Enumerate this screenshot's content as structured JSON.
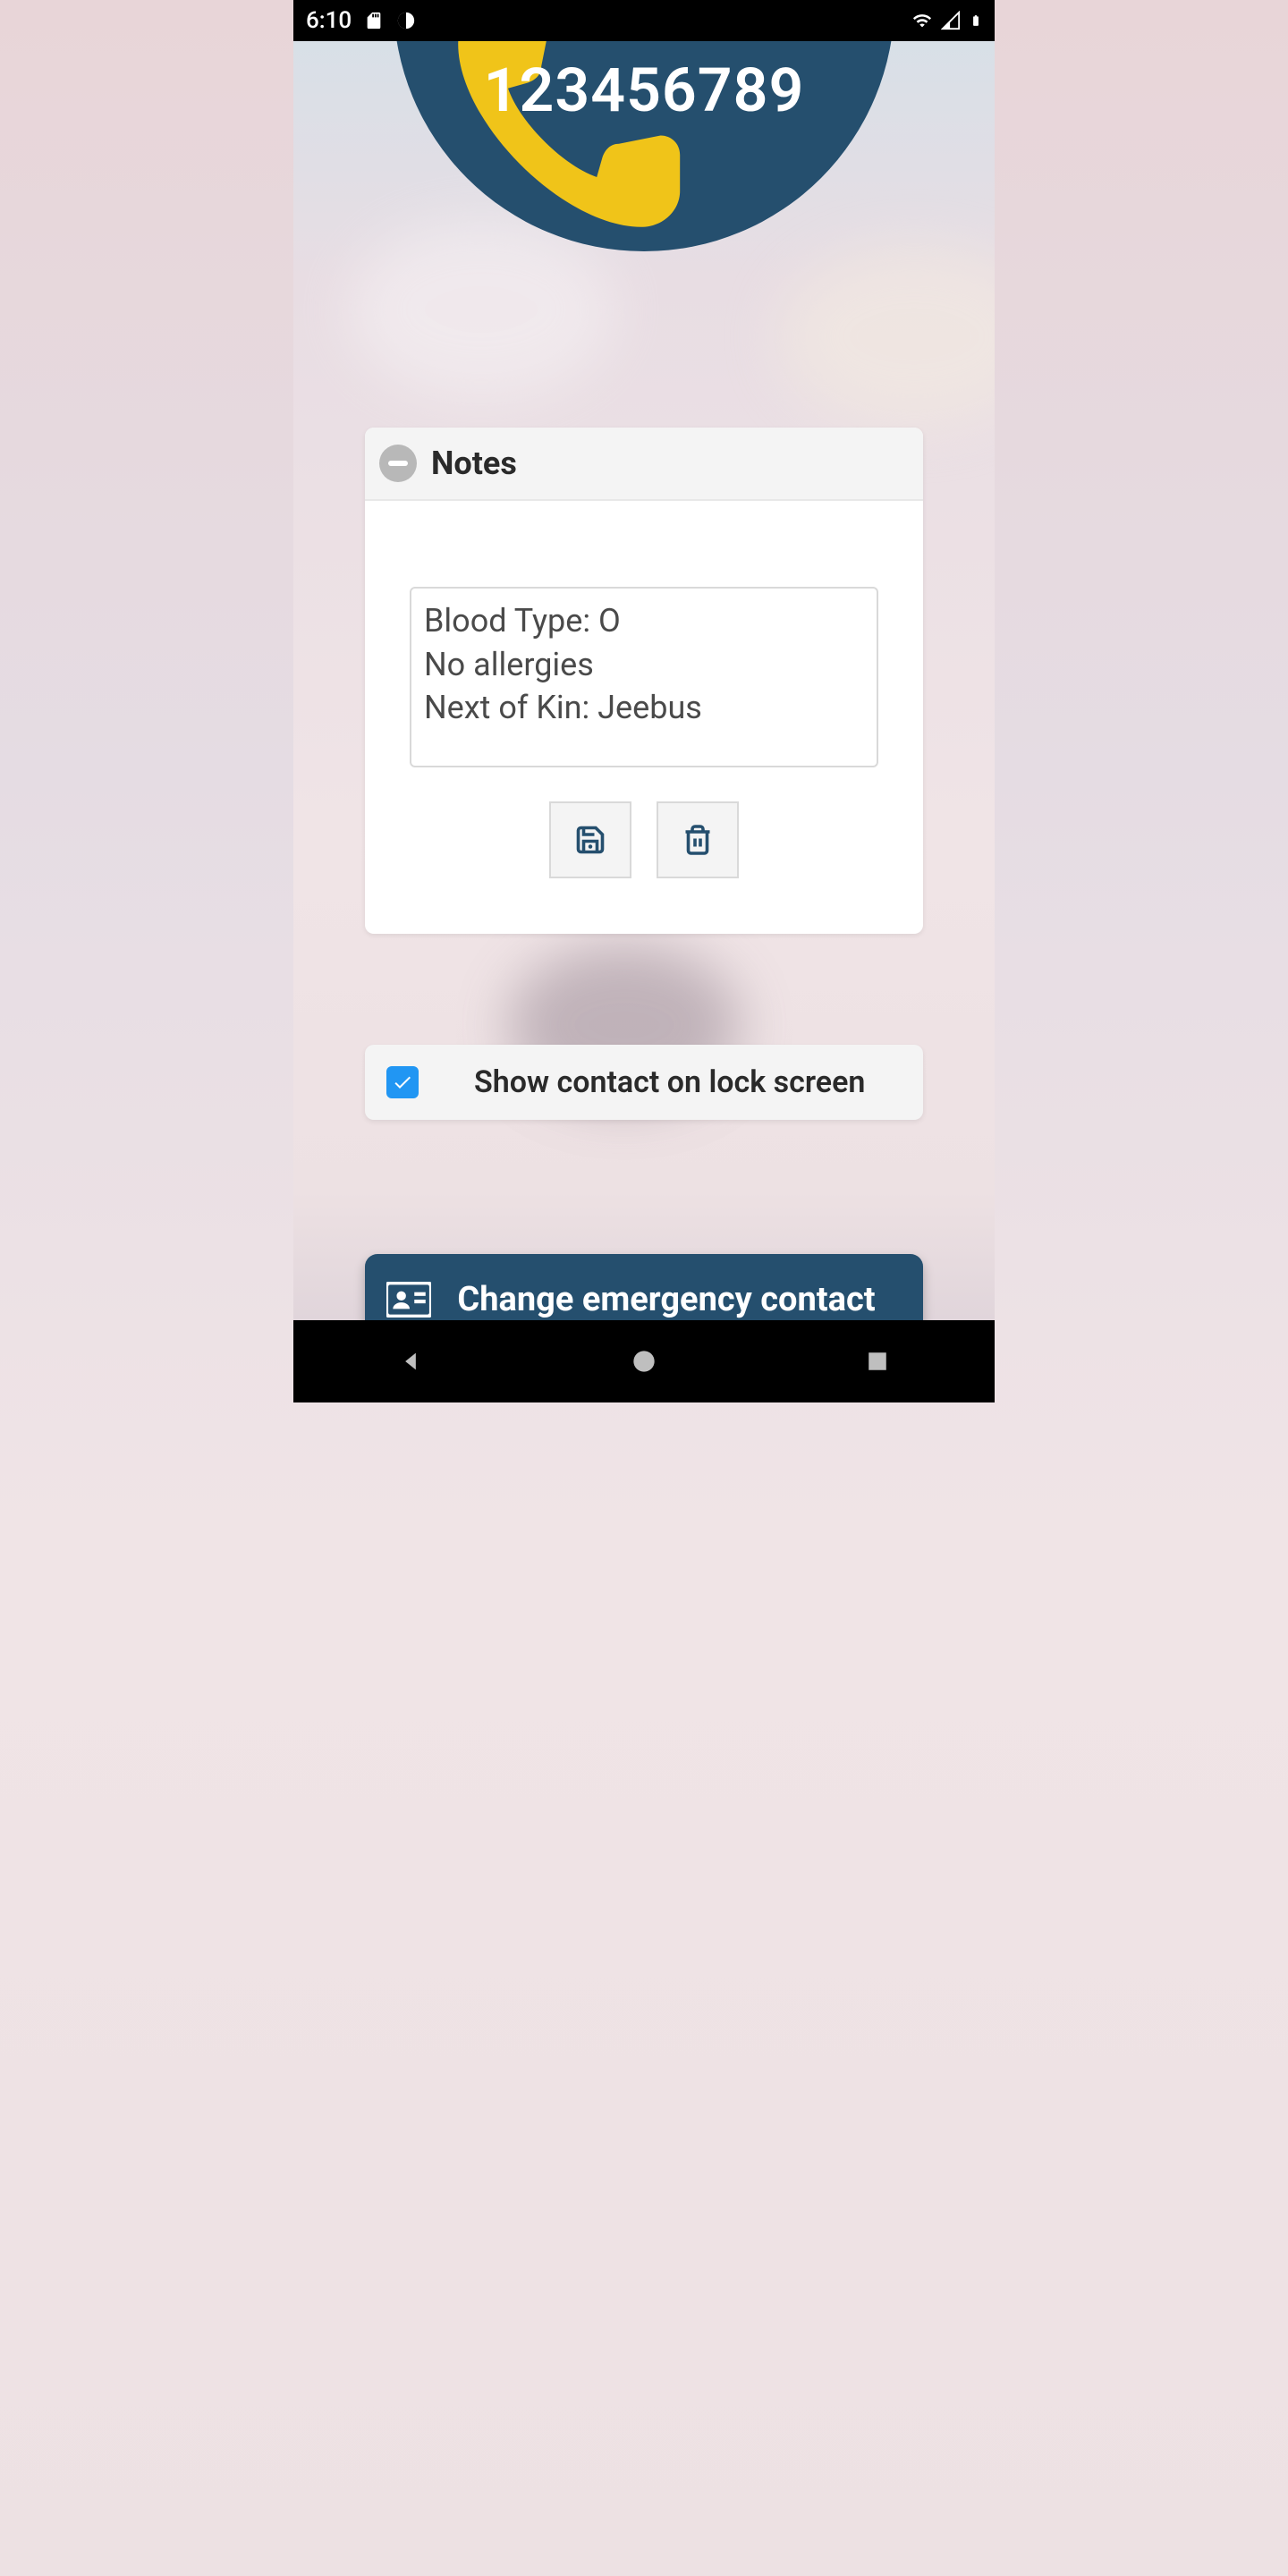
{
  "status": {
    "time": "6:10"
  },
  "contact": {
    "phone_number": "123456789"
  },
  "notes": {
    "title": "Notes",
    "content": "Blood Type: O\nNo allergies\nNext of Kin: Jeebus"
  },
  "lockscreen": {
    "label": "Show contact on lock screen",
    "checked": true
  },
  "change_button": {
    "label": "Change emergency contact"
  },
  "colors": {
    "primary": "#254f6e",
    "accent_yellow": "#f0c419",
    "checkbox_blue": "#2196f3"
  }
}
